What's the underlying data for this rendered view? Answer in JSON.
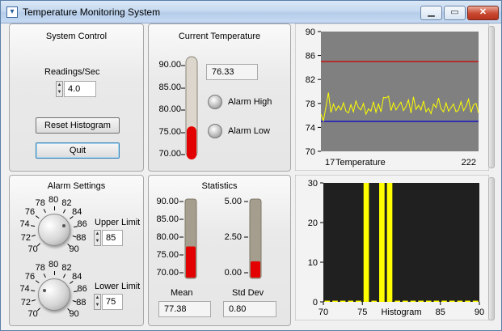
{
  "window": {
    "title": "Temperature Monitoring System"
  },
  "system_control": {
    "title": "System Control",
    "readings_label": "Readings/Sec",
    "readings_value": "4.0",
    "reset_label": "Reset Histogram",
    "quit_label": "Quit"
  },
  "current_temperature": {
    "title": "Current Temperature",
    "value": "76.33",
    "scale": [
      "90.00",
      "85.00",
      "80.00",
      "75.00",
      "70.00"
    ],
    "alarm_high_label": "Alarm High",
    "alarm_low_label": "Alarm Low"
  },
  "alarm_settings": {
    "title": "Alarm Settings",
    "dial_labels": [
      "70",
      "72",
      "74",
      "76",
      "78",
      "80",
      "82",
      "84",
      "86",
      "88",
      "90"
    ],
    "upper_label": "Upper Limit",
    "upper_value": "85",
    "lower_label": "Lower Limit",
    "lower_value": "75"
  },
  "statistics": {
    "title": "Statistics",
    "mean_scale": [
      "90.00",
      "85.00",
      "80.00",
      "75.00",
      "70.00"
    ],
    "std_scale": [
      "5.00",
      "2.50",
      "0.00"
    ],
    "mean_label": "Mean",
    "mean_value": "77.38",
    "std_label": "Std Dev",
    "std_value": "0.80"
  },
  "chart_data": [
    {
      "type": "line",
      "ylim": [
        70,
        90
      ],
      "y_ticks": [
        "90",
        "86",
        "82",
        "78",
        "74",
        "70"
      ],
      "x_left_label": "17",
      "x_title": "Temperature",
      "x_right_label": "222",
      "upper_limit": 85,
      "lower_limit": 75,
      "series": [
        {
          "values": [
            76.2,
            75.1,
            77.4,
            79.8,
            76.5,
            77.9,
            76.8,
            77.6,
            76.9,
            78.1,
            76.7,
            76.4,
            77.8,
            76.6,
            78.4,
            77.3,
            76.9,
            78.0,
            76.2,
            77.1,
            76.7,
            78.3,
            76.5,
            77.9,
            76.6,
            79.0,
            78.9,
            79.2,
            76.8,
            78.1,
            76.9,
            77.6,
            78.2,
            76.8,
            77.5,
            78.6,
            76.4,
            79.1,
            77.0,
            77.7,
            76.9,
            78.4,
            76.6,
            77.2,
            76.3,
            77.9,
            77.3,
            78.9,
            77.1,
            76.6,
            78.1,
            76.7,
            77.3,
            77.9,
            76.6,
            76.9,
            78.3,
            76.8,
            77.5,
            78.7,
            76.5,
            77.8,
            78.0,
            76.4
          ]
        }
      ],
      "colors": {
        "background": "#808080",
        "line": "#ffff00",
        "upper": "#cc0000",
        "lower": "#0000cc"
      }
    },
    {
      "type": "bar",
      "x_ticks": [
        "70",
        "75",
        "Histogram",
        "85",
        "90"
      ],
      "y_ticks": [
        "30",
        "20",
        "10",
        "0"
      ],
      "ylim": [
        0,
        30
      ],
      "xlim": [
        70,
        90
      ],
      "bins": [
        {
          "x": 70,
          "value": 0.3
        },
        {
          "x": 71,
          "value": 0.3
        },
        {
          "x": 72,
          "value": 0.3
        },
        {
          "x": 73,
          "value": 0.3
        },
        {
          "x": 74,
          "value": 0.3
        },
        {
          "x": 75,
          "value": 30
        },
        {
          "x": 76,
          "value": 0.3
        },
        {
          "x": 77,
          "value": 30
        },
        {
          "x": 78,
          "value": 30
        },
        {
          "x": 79,
          "value": 0.3
        },
        {
          "x": 80,
          "value": 0.3
        },
        {
          "x": 81,
          "value": 0.3
        },
        {
          "x": 82,
          "value": 0.3
        },
        {
          "x": 83,
          "value": 0.3
        },
        {
          "x": 84,
          "value": 0.3
        },
        {
          "x": 85,
          "value": 0.3
        },
        {
          "x": 86,
          "value": 0.3
        },
        {
          "x": 87,
          "value": 0.3
        },
        {
          "x": 88,
          "value": 0.3
        },
        {
          "x": 89,
          "value": 0.3
        }
      ],
      "colors": {
        "background": "#202020",
        "bar": "#ffff00"
      }
    }
  ],
  "levels": {
    "current_temperature": 76.33,
    "mean": 77.38,
    "std_dev": 0.8,
    "upper_knob": 85,
    "lower_knob": 75
  }
}
